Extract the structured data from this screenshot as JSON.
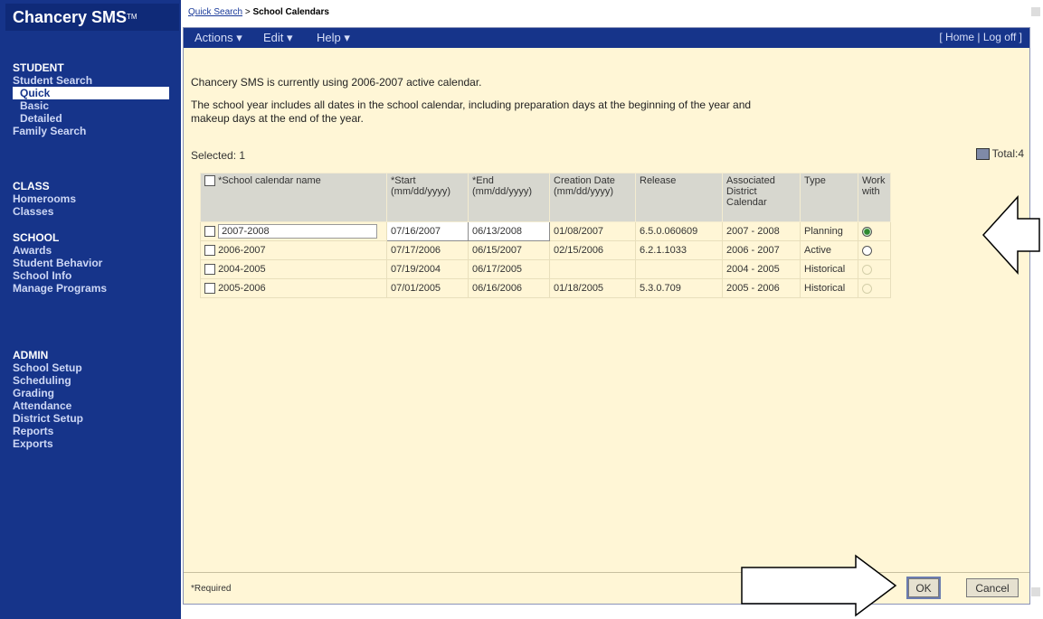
{
  "app": {
    "logo": "Chancery SMS",
    "logo_tm": "TM"
  },
  "breadcrumb": {
    "link": "Quick Search",
    "separator": ">",
    "current": "School Calendars"
  },
  "menubar": {
    "actions": "Actions ▾",
    "edit": "Edit ▾",
    "help": "Help ▾",
    "home": "Home",
    "logoff": "Log off"
  },
  "sidebar": {
    "student": {
      "head": "STUDENT",
      "items": [
        "Student Search",
        "Quick",
        "Basic",
        "Detailed",
        "Family Search"
      ]
    },
    "class": {
      "head": "CLASS",
      "items": [
        "Homerooms",
        "Classes"
      ]
    },
    "school": {
      "head": "SCHOOL",
      "items": [
        "Awards",
        "Student Behavior",
        "School Info",
        "Manage Programs"
      ]
    },
    "admin": {
      "head": "ADMIN",
      "items": [
        "School Setup",
        "Scheduling",
        "Grading",
        "Attendance",
        "District Setup",
        "Reports",
        "Exports"
      ]
    }
  },
  "main": {
    "active_calendar_msg": "Chancery SMS is currently using 2006-2007 active calendar.",
    "info_line1": "The school year includes all dates in the school calendar, including preparation days at the beginning of the year and",
    "info_line2": "makeup days at the end of the year.",
    "selected_label": "Selected: 1",
    "total_label": "Total:4"
  },
  "table": {
    "headers": {
      "name": "*School calendar name",
      "start": "*Start (mm/dd/yyyy)",
      "end": "*End (mm/dd/yyyy)",
      "creation": "Creation Date (mm/dd/yyyy)",
      "release": "Release",
      "district": "Associated District Calendar",
      "type": "Type",
      "work": "Work with"
    },
    "rows": [
      {
        "name": "2007-2008",
        "start": "07/16/2007",
        "end": "06/13/2008",
        "creation": "01/08/2007",
        "release": "6.5.0.060609",
        "district": "2007 - 2008",
        "type": "Planning"
      },
      {
        "name": "2006-2007",
        "start": "07/17/2006",
        "end": "06/15/2007",
        "creation": "02/15/2006",
        "release": "6.2.1.1033",
        "district": "2006 - 2007",
        "type": "Active"
      },
      {
        "name": "2004-2005",
        "start": "07/19/2004",
        "end": "06/17/2005",
        "creation": "",
        "release": "",
        "district": "2004 - 2005",
        "type": "Historical"
      },
      {
        "name": "2005-2006",
        "start": "07/01/2005",
        "end": "06/16/2006",
        "creation": "01/18/2005",
        "release": "5.3.0.709",
        "district": "2005 - 2006",
        "type": "Historical"
      }
    ]
  },
  "footer": {
    "required": "*Required",
    "ok": "OK",
    "cancel": "Cancel"
  },
  "colors": {
    "nav_blue": "#16348a",
    "panel": "#fff6d6",
    "header_gray": "#d7d7cf"
  }
}
